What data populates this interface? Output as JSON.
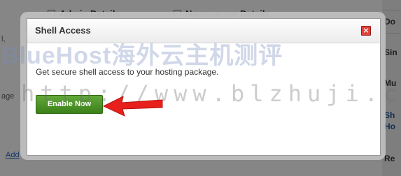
{
  "background": {
    "tabs": [
      "Admin Details",
      "Nameserver Details"
    ],
    "left_fragments": [
      "l,",
      "age"
    ],
    "left_link": "Add",
    "right_items": [
      {
        "label": "Do",
        "style": "normal"
      },
      {
        "label": "Sin",
        "style": "normal"
      },
      {
        "label": "Mu",
        "style": "normal"
      },
      {
        "label": "Sh",
        "style": "blue"
      },
      {
        "label": "Ho",
        "style": "blue"
      },
      {
        "label": "Re",
        "style": "normal"
      }
    ]
  },
  "modal": {
    "title": "Shell Access",
    "close_glyph": "×",
    "body_text": "Get secure shell access to your hosting package.",
    "primary_button": "Enable Now"
  },
  "watermark": {
    "line1": "BlueHost海外云主机测评",
    "line2": "http://www.blzhuji.com/"
  },
  "colors": {
    "button_green": "#4e9a2a",
    "close_red": "#e0413b",
    "arrow_red": "#e8201c"
  }
}
